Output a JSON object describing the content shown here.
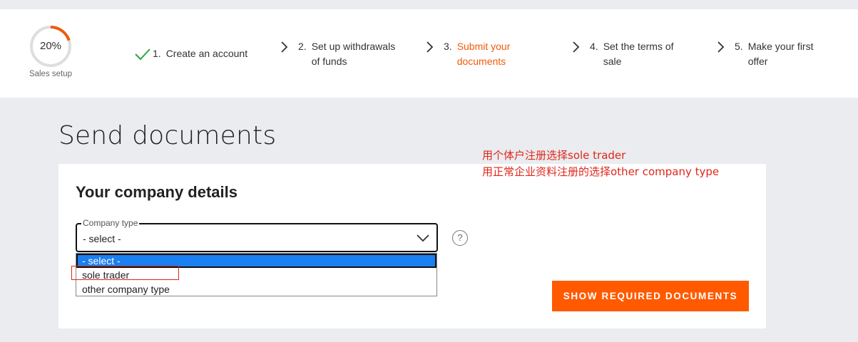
{
  "progress": {
    "percent_label": "20%",
    "percent_value": 20,
    "caption": "Sales setup",
    "accent_color": "#f05a0a"
  },
  "steps": [
    {
      "number": "1.",
      "label": "Create an account",
      "status": "done",
      "icon": "checkmark-icon"
    },
    {
      "number": "2.",
      "label": "Set up withdrawals of funds",
      "label_lines": [
        "Set up withdrawals",
        "of funds"
      ],
      "status": "pending",
      "icon": "chevron-right-icon"
    },
    {
      "number": "3.",
      "label": "Submit your documents",
      "label_lines": [
        "Submit your",
        "documents"
      ],
      "status": "active",
      "icon": "chevron-right-icon"
    },
    {
      "number": "4.",
      "label": "Set the terms of sale",
      "label_lines": [
        "Set the terms of",
        "sale"
      ],
      "status": "pending",
      "icon": "chevron-right-icon"
    },
    {
      "number": "5.",
      "label": "Make your first offer",
      "label_lines": [
        "Make your first",
        "offer"
      ],
      "status": "pending",
      "icon": "chevron-right-icon"
    }
  ],
  "page": {
    "title": "Send documents"
  },
  "annotation": {
    "lines": [
      "用个体户注册选择sole trader",
      "用正常企业资料注册的选择other company type"
    ],
    "color": "#e0261b"
  },
  "company_details": {
    "title": "Your company details",
    "company_type": {
      "legend": "Company type",
      "value": "- select -",
      "options": [
        "- select -",
        "sole trader",
        "other company type"
      ],
      "highlighted_option": "- select -"
    },
    "help_icon_glyph": "?",
    "submit_label": "SHOW REQUIRED DOCUMENTS",
    "submit_color": "#ff5a00"
  }
}
